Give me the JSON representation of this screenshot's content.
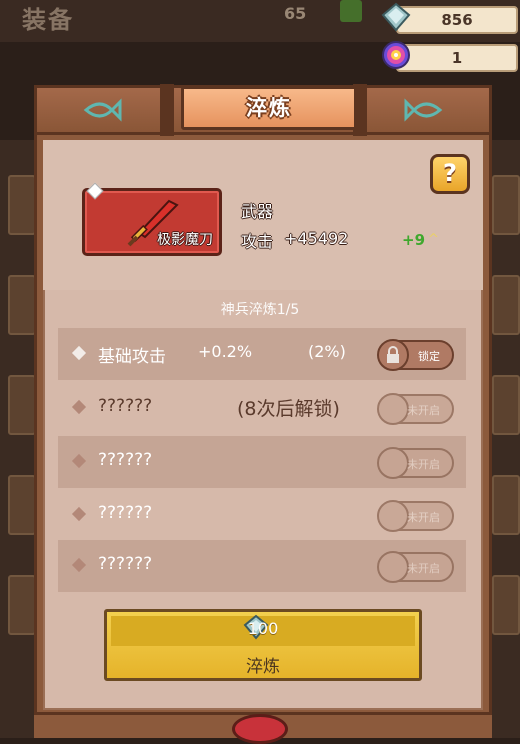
{
  "background": {
    "title": "装备",
    "level": "65"
  },
  "currencies": [
    {
      "icon": "diamond-gem-icon",
      "value": "856"
    },
    {
      "icon": "rainbow-orb-icon",
      "value": "1"
    }
  ],
  "panel": {
    "title": "淬炼",
    "help_label": "?"
  },
  "item": {
    "name": "极影魔刀",
    "type": "武器",
    "stat_label": "攻击",
    "stat_value": "+45492",
    "enhance_level": "+9",
    "up_arrow": "^"
  },
  "tier_text": "神兵淬炼1/5",
  "rows": [
    {
      "name": "基础攻击",
      "value": "+0.2%",
      "percent": "(2%)",
      "button": "锁定",
      "state": "unlocked"
    },
    {
      "name": "??????",
      "unlock_hint": "(8次后解锁)",
      "button": "未开启",
      "state": "locked"
    },
    {
      "name": "??????",
      "button": "未开启",
      "state": "locked"
    },
    {
      "name": "??????",
      "button": "未开启",
      "state": "locked"
    },
    {
      "name": "??????",
      "button": "未开启",
      "state": "locked"
    }
  ],
  "refine_button": {
    "cost": "100",
    "label": "淬炼"
  },
  "colors": {
    "wood": "#8c5a3c",
    "parchment": "#d6b9aa",
    "gold_button": "#f3d04f",
    "red_item": "#c23a32",
    "green_plus": "#3fa82d"
  }
}
